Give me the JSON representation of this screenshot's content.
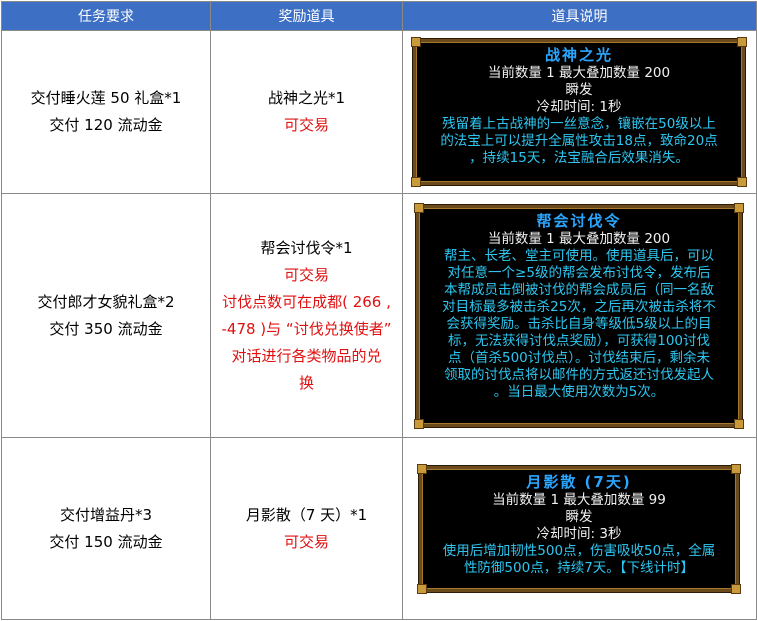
{
  "headers": [
    "任务要求",
    "奖励道具",
    "道具说明"
  ],
  "rows": [
    {
      "req": [
        "交付睡火莲 50 礼盒*1",
        "交付 120 流动金"
      ],
      "reward": "战神之光*1",
      "tradable": "可交易",
      "note": [],
      "tip": {
        "title": "战神之光",
        "count_line": "当前数量 1 最大叠加数量 200",
        "instant": "瞬发",
        "cooldown": "冷却时间:  1秒",
        "desc": [
          "残留着上古战神的一丝意念，镶嵌在50级以上",
          "的法宝上可以提升全属性攻击18点，致命20点",
          "，持续15天，法宝融合后效果消失。"
        ]
      }
    },
    {
      "req": [
        "交付郎才女貌礼盒*2",
        "交付 350 流动金"
      ],
      "reward": "帮会讨伐令*1",
      "tradable": "可交易",
      "note": [
        "讨伐点数可在成都( 266 ,",
        "-478 )与 “讨伐兑换使者”",
        "对话进行各类物品的兑",
        "换"
      ],
      "tip": {
        "title": "帮会讨伐令",
        "count_line": "当前数量 1 最大叠加数量 200",
        "desc": [
          "帮主、长老、堂主可使用。使用道具后，可以",
          "对任意一个≥5级的帮会发布讨伐令，发布后",
          "本帮成员击倒被讨伐的帮会成员后（同一名敌",
          "对目标最多被击杀25次，之后再次被击杀将不",
          "会获得奖励。击杀比自身等级低5级以上的目",
          "标，无法获得讨伐点奖励），可获得100讨伐",
          "点（首杀500讨伐点）。讨伐结束后，剩余未",
          "领取的讨伐点将以邮件的方式返还讨伐发起人",
          "。当日最大使用次数为5次。"
        ]
      }
    },
    {
      "req": [
        "交付增益丹*3",
        "交付 150 流动金"
      ],
      "reward": "月影散（7 天）*1",
      "tradable": "可交易",
      "note": [],
      "tip": {
        "title": "月影散 (7天)",
        "count_line": "当前数量 1 最大叠加数量 99",
        "instant": "瞬发",
        "cooldown": "冷却时间:  3秒",
        "desc": [
          "使用后增加韧性500点，伤害吸收50点，全属",
          "性防御500点，持续7天。【下线计时】"
        ]
      }
    }
  ]
}
